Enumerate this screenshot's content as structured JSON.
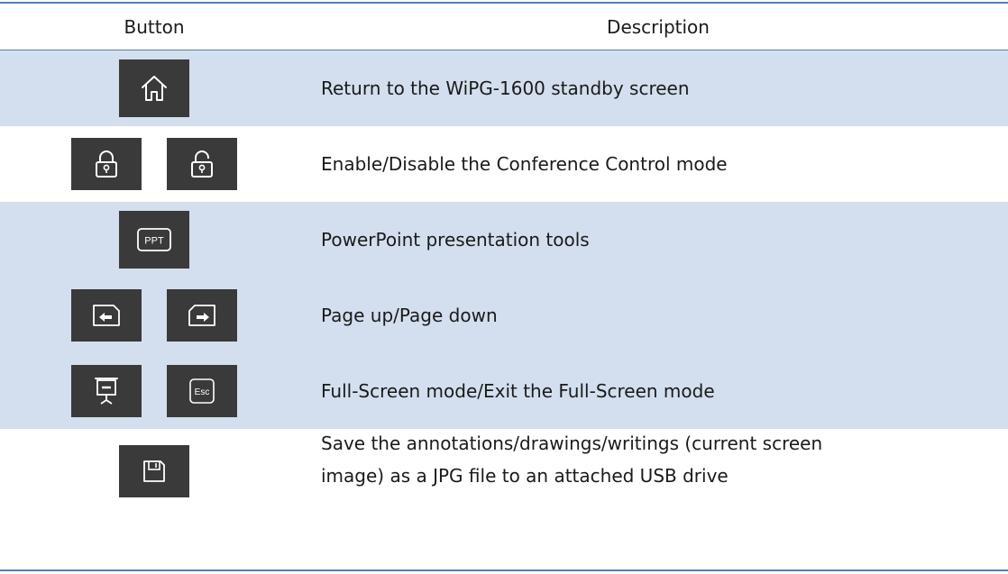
{
  "table": {
    "headers": {
      "button": "Button",
      "description": "Description"
    },
    "rows": [
      {
        "icons": [
          "home-icon"
        ],
        "description": "Return to the WiPG-1600 standby screen"
      },
      {
        "icons": [
          "lock-icon",
          "unlock-icon"
        ],
        "description": "Enable/Disable the Conference Control mode"
      },
      {
        "icons": [
          "ppt-icon"
        ],
        "icon_label": "PPT",
        "description": "PowerPoint presentation tools"
      },
      {
        "icons": [
          "page-up-icon",
          "page-down-icon"
        ],
        "description": "Page up/Page down"
      },
      {
        "icons": [
          "fullscreen-icon",
          "esc-icon"
        ],
        "icon_label": "Esc",
        "description": "Full-Screen mode/Exit the Full-Screen mode"
      },
      {
        "icons": [
          "save-icon"
        ],
        "description_lines": [
          "Save the annotations/drawings/writings (current screen",
          "image) as a JPG file to an attached USB drive"
        ]
      }
    ]
  },
  "colors": {
    "rule": "#4f81bd",
    "shaded_row": "#d3dfee",
    "icon_bg": "#3a3a3a",
    "icon_stroke": "#ffffff"
  }
}
